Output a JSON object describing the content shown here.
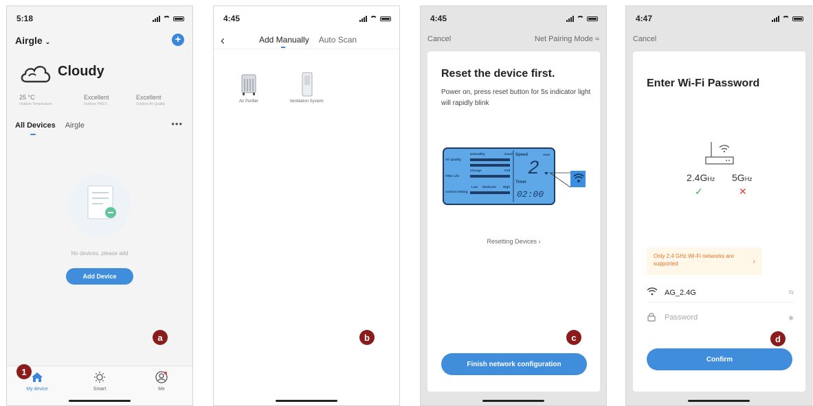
{
  "colors": {
    "accent": "#3f8ddb",
    "badge": "#8b1c1c",
    "ok": "#3cb04b",
    "bad": "#e0403a",
    "warn": "#e8712a"
  },
  "phone_a": {
    "time": "5:18",
    "home_name": "Airgle",
    "weather": "Cloudy",
    "stats": [
      {
        "value": "25 °C",
        "label": "Outdoor Temperature"
      },
      {
        "value": "Excellent",
        "label": "Outdoor PM2.5"
      },
      {
        "value": "Excellent",
        "label": "Outdoor Air Quality"
      }
    ],
    "tabs": {
      "active": "All Devices",
      "other": "Airgle"
    },
    "empty_text": "No devices, please add",
    "add_button": "Add Device",
    "tabbar": [
      "My device",
      "Smart",
      "Me"
    ],
    "step_badge": "1",
    "panel_badge": "a"
  },
  "phone_b": {
    "time": "4:45",
    "tab_manual": "Add Manually",
    "tab_auto": "Auto Scan",
    "devices": [
      "Air Purifier",
      "Ventilation System"
    ],
    "panel_badge": "b"
  },
  "phone_c": {
    "time": "4:45",
    "cancel": "Cancel",
    "mode": "Net Pairing Mode ≈",
    "title": "Reset the device first.",
    "desc": "Power on, press reset button for 5s indicator light will rapidly blink",
    "resetting": "Resetting Devices ›",
    "finish_button": "Finish network configuration",
    "panel_badge": "c",
    "lcd": {
      "speed_label": "Speed",
      "speed_value": "2",
      "auto": "Auto",
      "timer_label": "Timer",
      "timer_value": "02:00",
      "air_quality": "Air Quality",
      "filter_life": "Filter Life",
      "control_setting": "Control Setting",
      "unhealthy": "Unhealthy",
      "good": "Good",
      "change": "Change",
      "full": "Full",
      "low": "Low",
      "moderate": "Moderate",
      "high": "High"
    }
  },
  "phone_d": {
    "time": "4:47",
    "cancel": "Cancel",
    "title": "Enter Wi-Fi Password",
    "band_24": "2.4G",
    "band_5": "5G",
    "band_unit": "Hz",
    "check_ok": "✓",
    "check_bad": "✕",
    "notice": "Only 2.4 GHz Wi-Fi networks are supported",
    "ssid": "AG_2.4G",
    "password_placeholder": "Password",
    "confirm_button": "Confirm",
    "panel_badge": "d"
  }
}
